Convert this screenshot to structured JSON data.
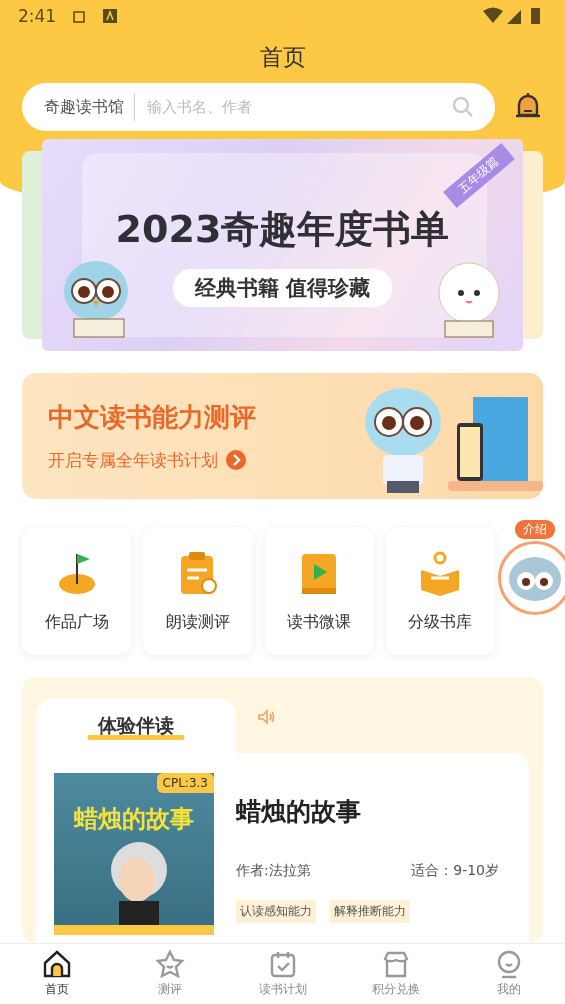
{
  "status_bar": {
    "time": "2:41"
  },
  "header": {
    "title": "首页"
  },
  "search": {
    "library": "奇趣读书馆",
    "placeholder": "输入书名、作者"
  },
  "banner": {
    "title": "2023奇趣年度书单",
    "subtitle": "经典书籍 值得珍藏",
    "ribbon": "五年级篇"
  },
  "promo": {
    "title": "中文读书能力测评",
    "subtitle": "开启专属全年读书计划"
  },
  "floating": {
    "label": "介绍"
  },
  "features": [
    {
      "label": "作品广场",
      "kind": "flag"
    },
    {
      "label": "朗读测评",
      "kind": "clipboard"
    },
    {
      "label": "读书微课",
      "kind": "play"
    },
    {
      "label": "分级书库",
      "kind": "book"
    }
  ],
  "reading": {
    "tab": "体验伴读",
    "book": {
      "level": "CPL:3.3",
      "cover_title": "蜡烛的故事",
      "title": "蜡烛的故事",
      "author": "作者:法拉第",
      "age": "适合：9-10岁",
      "tags": [
        "认读感知能力",
        "解释推断能力"
      ]
    }
  },
  "nav": [
    {
      "label": "首页",
      "kind": "home",
      "selected": true
    },
    {
      "label": "测评",
      "kind": "star",
      "selected": false
    },
    {
      "label": "读书计划",
      "kind": "calendar",
      "selected": false
    },
    {
      "label": "积分兑换",
      "kind": "shop",
      "selected": false
    },
    {
      "label": "我的",
      "kind": "face",
      "selected": false
    }
  ]
}
